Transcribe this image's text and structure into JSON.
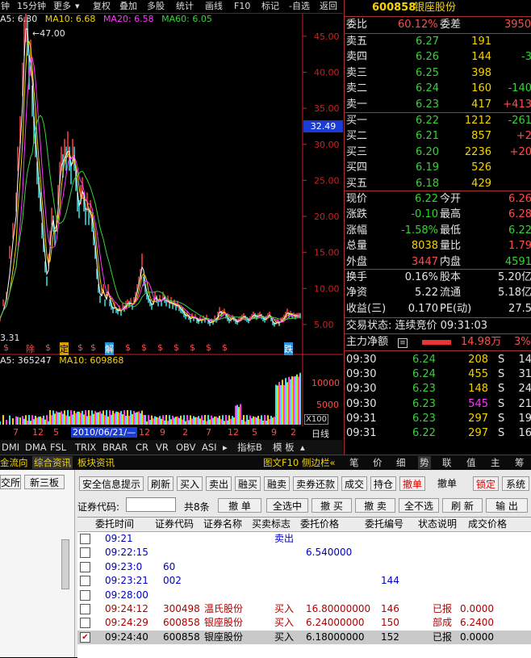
{
  "toolbar": {
    "items": [
      "钟",
      "15分钟",
      "更多",
      "复权",
      "叠加",
      "多股",
      "统计",
      "画线",
      "F10",
      "标记",
      "-自选",
      "返回"
    ]
  },
  "main_chart": {
    "ma_label": "A5: 6.30",
    "ma10_label": "MA10: 6.68",
    "ma20_label": "MA20: 6.58",
    "ma60_label": "MA60: 6.05",
    "peak_label": "47.00",
    "low_label": "3.31",
    "price_tag": "32.49",
    "markers": [
      "$",
      "除",
      "定",
      "解",
      "跌"
    ],
    "colors": {
      "ma5": "#ffffff",
      "ma10": "#f5d300",
      "ma20": "#ff37ff",
      "ma60": "#37d237",
      "axis": "#cc2222"
    }
  },
  "chart_data": {
    "type": "line",
    "y_ticks": [
      "45.00",
      "40.00",
      "35.00",
      "30.00",
      "25.00",
      "20.00",
      "15.00",
      "10.00",
      "5.00"
    ],
    "ylim": [
      3.31,
      47.0
    ],
    "price_path": [
      [
        0,
        5.8
      ],
      [
        4,
        8
      ],
      [
        8,
        9
      ],
      [
        12,
        15
      ],
      [
        16,
        18
      ],
      [
        20,
        22
      ],
      [
        22,
        28
      ],
      [
        25,
        32
      ],
      [
        28,
        39
      ],
      [
        30,
        45
      ],
      [
        32,
        47
      ],
      [
        34,
        45
      ],
      [
        36,
        40
      ],
      [
        38,
        42
      ],
      [
        40,
        36
      ],
      [
        42,
        32
      ],
      [
        44,
        30
      ],
      [
        46,
        26
      ],
      [
        48,
        24
      ],
      [
        50,
        22
      ],
      [
        52,
        18
      ],
      [
        54,
        16
      ],
      [
        56,
        13
      ],
      [
        58,
        11
      ],
      [
        60,
        14
      ],
      [
        62,
        17
      ],
      [
        64,
        20
      ],
      [
        66,
        19
      ],
      [
        68,
        17
      ],
      [
        70,
        19
      ],
      [
        72,
        23
      ],
      [
        74,
        26
      ],
      [
        76,
        28
      ],
      [
        78,
        27
      ],
      [
        80,
        29
      ],
      [
        82,
        28
      ],
      [
        84,
        30
      ],
      [
        86,
        28
      ],
      [
        88,
        26
      ],
      [
        90,
        29
      ],
      [
        92,
        28
      ],
      [
        94,
        25
      ],
      [
        96,
        22
      ],
      [
        98,
        21
      ],
      [
        100,
        23
      ],
      [
        102,
        24
      ],
      [
        104,
        22
      ],
      [
        106,
        20
      ],
      [
        108,
        22
      ],
      [
        110,
        20
      ],
      [
        112,
        21
      ],
      [
        114,
        19
      ],
      [
        116,
        17
      ],
      [
        118,
        15
      ],
      [
        120,
        12
      ],
      [
        122,
        10
      ],
      [
        124,
        8.5
      ],
      [
        126,
        9.5
      ],
      [
        128,
        10
      ],
      [
        130,
        8
      ],
      [
        132,
        9
      ],
      [
        134,
        10
      ],
      [
        136,
        8
      ],
      [
        138,
        7.5
      ],
      [
        140,
        7
      ],
      [
        142,
        7.6
      ],
      [
        144,
        7
      ],
      [
        146,
        6.8
      ],
      [
        148,
        7.2
      ],
      [
        150,
        6.6
      ],
      [
        152,
        7.5
      ],
      [
        154,
        7.2
      ],
      [
        156,
        7.8
      ],
      [
        158,
        8
      ],
      [
        160,
        7.8
      ],
      [
        162,
        8.2
      ],
      [
        164,
        7.5
      ],
      [
        166,
        8.3
      ],
      [
        168,
        9
      ],
      [
        170,
        10
      ],
      [
        172,
        11
      ],
      [
        174,
        12
      ],
      [
        176,
        14
      ],
      [
        178,
        11
      ],
      [
        180,
        10
      ],
      [
        182,
        9
      ],
      [
        184,
        8.5
      ],
      [
        186,
        8
      ],
      [
        188,
        7.5
      ],
      [
        190,
        8.2
      ],
      [
        192,
        9
      ],
      [
        194,
        8.5
      ],
      [
        196,
        8
      ],
      [
        198,
        8.6
      ],
      [
        200,
        8
      ],
      [
        202,
        9
      ],
      [
        204,
        8.5
      ],
      [
        206,
        8
      ],
      [
        208,
        8.5
      ],
      [
        210,
        7.7
      ],
      [
        212,
        8.3
      ],
      [
        214,
        7.6
      ],
      [
        216,
        8
      ],
      [
        218,
        7.4
      ],
      [
        220,
        7.8
      ],
      [
        222,
        7.3
      ],
      [
        224,
        7
      ],
      [
        226,
        6.9
      ],
      [
        228,
        6.4
      ],
      [
        230,
        6.1
      ],
      [
        232,
        6.4
      ],
      [
        234,
        6
      ],
      [
        236,
        5.6
      ],
      [
        238,
        6.2
      ],
      [
        240,
        5.8
      ],
      [
        242,
        6.1
      ],
      [
        244,
        5.5
      ],
      [
        246,
        5.4
      ],
      [
        248,
        5.8
      ],
      [
        250,
        5.5
      ],
      [
        252,
        5.9
      ],
      [
        254,
        5.6
      ],
      [
        256,
        6
      ],
      [
        258,
        5.4
      ],
      [
        260,
        5.1
      ],
      [
        262,
        5.5
      ],
      [
        264,
        5.3
      ],
      [
        266,
        5.9
      ],
      [
        268,
        5.6
      ],
      [
        270,
        6.4
      ],
      [
        272,
        7
      ],
      [
        274,
        6.5
      ],
      [
        276,
        6.6
      ],
      [
        278,
        6.8
      ],
      [
        280,
        6.2
      ],
      [
        282,
        5.8
      ],
      [
        284,
        5.5
      ],
      [
        286,
        5.7
      ],
      [
        288,
        6
      ],
      [
        290,
        5.8
      ],
      [
        292,
        5.4
      ],
      [
        294,
        5.3
      ],
      [
        296,
        5.6
      ],
      [
        298,
        5.8
      ],
      [
        300,
        6
      ],
      [
        302,
        6.2
      ],
      [
        304,
        5.9
      ],
      [
        306,
        5.7
      ],
      [
        308,
        5.5
      ],
      [
        310,
        5.8
      ],
      [
        312,
        6.1
      ],
      [
        314,
        6.4
      ],
      [
        316,
        6.2
      ],
      [
        318,
        6
      ],
      [
        320,
        6.2
      ],
      [
        322,
        6.4
      ],
      [
        324,
        6.1
      ],
      [
        326,
        5.8
      ],
      [
        328,
        5.6
      ],
      [
        330,
        5.9
      ],
      [
        332,
        6.2
      ],
      [
        334,
        6.4
      ],
      [
        336,
        5.8
      ],
      [
        338,
        5.2
      ],
      [
        340,
        5
      ],
      [
        342,
        5.3
      ],
      [
        344,
        5.4
      ],
      [
        346,
        5.1
      ],
      [
        348,
        5.6
      ],
      [
        350,
        5.7
      ],
      [
        352,
        6
      ],
      [
        354,
        6.4
      ],
      [
        356,
        6.8
      ],
      [
        358,
        6.3
      ],
      [
        360,
        6.5
      ],
      [
        362,
        6.2
      ],
      [
        364,
        6.3
      ],
      [
        366,
        6.1
      ],
      [
        368,
        6.2
      ],
      [
        370,
        6.25
      ],
      [
        372,
        6.22
      ]
    ]
  },
  "volume": {
    "label_a5": "A5: 365247",
    "label_ma10": "MA10: 609868",
    "ticks": [
      "10000",
      "5000",
      "X100"
    ],
    "date_tag": "2010/06/21/—",
    "date_ticks": [
      "7",
      "12",
      "5",
      "5",
      "12",
      "9",
      "2",
      "7",
      "12",
      "5",
      "9",
      "2"
    ]
  },
  "bottom_tabs": [
    "DMI",
    "DMA",
    "FSL",
    "TRIX",
    "BRAR",
    "CR",
    "VR",
    "OBV",
    "ASI",
    "指标B",
    "模 板",
    "日线"
  ],
  "tabs2": {
    "left": [
      "金流向",
      "综合资讯",
      "板块资讯"
    ],
    "right": [
      "图文F10",
      "侧边栏«",
      "笔",
      "价",
      "细",
      "势",
      "联",
      "值",
      "主",
      "筹"
    ]
  },
  "quote": {
    "code": "600858",
    "name": "银座股份",
    "wb_label": "委比",
    "wb_value": "60.12%",
    "wc_label": "委差",
    "wc_value": "3950",
    "sells": [
      {
        "label": "卖五",
        "price": "6.27",
        "vol": "191",
        "chg": ""
      },
      {
        "label": "卖四",
        "price": "6.26",
        "vol": "144",
        "chg": "-3"
      },
      {
        "label": "卖三",
        "price": "6.25",
        "vol": "398",
        "chg": ""
      },
      {
        "label": "卖二",
        "price": "6.24",
        "vol": "160",
        "chg": "-140"
      },
      {
        "label": "卖一",
        "price": "6.23",
        "vol": "417",
        "chg": "+413"
      }
    ],
    "buys": [
      {
        "label": "买一",
        "price": "6.22",
        "vol": "1212",
        "chg": "-261"
      },
      {
        "label": "买二",
        "price": "6.21",
        "vol": "857",
        "chg": "+2"
      },
      {
        "label": "买三",
        "price": "6.20",
        "vol": "2236",
        "chg": "+20"
      },
      {
        "label": "买四",
        "price": "6.19",
        "vol": "526",
        "chg": ""
      },
      {
        "label": "买五",
        "price": "6.18",
        "vol": "429",
        "chg": ""
      }
    ],
    "stats": [
      {
        "l1": "现价",
        "v1": "6.22",
        "l2": "今开",
        "v2": "6.26"
      },
      {
        "l1": "涨跌",
        "v1": "-0.10",
        "l2": "最高",
        "v2": "6.28"
      },
      {
        "l1": "涨幅",
        "v1": "-1.58%",
        "l2": "最低",
        "v2": "6.22"
      },
      {
        "l1": "总量",
        "v1": "8038",
        "l2": "量比",
        "v2": "1.79"
      },
      {
        "l1": "外盘",
        "v1": "3447",
        "l2": "内盘",
        "v2": "4591"
      }
    ],
    "stats2": [
      {
        "l1": "换手",
        "v1": "0.16%",
        "l2": "股本",
        "v2": "5.20亿"
      },
      {
        "l1": "净资",
        "v1": "5.22",
        "l2": "流通",
        "v2": "5.18亿"
      },
      {
        "l1": "收益(三)",
        "v1": "0.170",
        "l2": "PE(动)",
        "v2": "27.5"
      }
    ],
    "trade_status": "交易状态: 连续竞价 09:31:03",
    "main_net_label": "主力净额",
    "main_net_value": "14.98万",
    "main_net_pct": "3%",
    "ticks": [
      {
        "time": "09:30",
        "price": "6.24",
        "vol": "208",
        "side": "S",
        "n": "14"
      },
      {
        "time": "09:30",
        "price": "6.24",
        "vol": "455",
        "side": "S",
        "n": "31"
      },
      {
        "time": "09:30",
        "price": "6.23",
        "vol": "148",
        "side": "S",
        "n": "24"
      },
      {
        "time": "09:30",
        "price": "6.23",
        "vol": "545",
        "side": "S",
        "n": "21"
      },
      {
        "time": "09:31",
        "price": "6.23",
        "vol": "297",
        "side": "S",
        "n": "19"
      },
      {
        "time": "09:31",
        "price": "6.22",
        "vol": "297",
        "side": "S",
        "n": "16"
      }
    ]
  },
  "trade": {
    "left_tabs": [
      "交所",
      "新三板"
    ],
    "buttons": [
      "安全信息提示",
      "刷新",
      "买入",
      "卖出",
      "融买",
      "融卖",
      "卖券还款",
      "成交",
      "持仓",
      "撤单",
      "撤单",
      "锁定",
      "系统"
    ],
    "code_label": "证券代码:",
    "count_label": "共8条",
    "action_buttons": [
      "撤 单",
      "全选中",
      "撤 买",
      "撤 卖",
      "全不选",
      "刷 新",
      "输 出"
    ],
    "headers": [
      "委托时间",
      "证券代码",
      "证券名称",
      "买卖标志",
      "委托价格",
      "委托编号",
      "状态说明",
      "成交价格"
    ],
    "rows": [
      {
        "time": "09:21",
        "code": "",
        "name": "",
        "flag": "卖出",
        "price": "",
        "id": "",
        "status": "",
        "deal": ""
      },
      {
        "time": "09:22:15",
        "code": "",
        "name": "",
        "flag": "",
        "price": "6.540000",
        "id": "",
        "status": "",
        "deal": ""
      },
      {
        "time": "09:23:0",
        "code": "60",
        "name": "",
        "flag": "",
        "price": "",
        "id": "",
        "status": "",
        "deal": ""
      },
      {
        "time": "09:23:21",
        "code": "002",
        "name": "",
        "flag": "",
        "price": "",
        "id": "144",
        "status": "",
        "deal": ""
      },
      {
        "time": "09:28:00",
        "code": "",
        "name": "",
        "flag": "",
        "price": "",
        "id": "",
        "status": "",
        "deal": ""
      },
      {
        "time": "09:24:12",
        "code": "300498",
        "name": "温氏股份",
        "flag": "买入",
        "price": "16.80000000",
        "id": "146",
        "status": "已报",
        "deal": "0.0000"
      },
      {
        "time": "09:24:29",
        "code": "600858",
        "name": "银座股份",
        "flag": "买入",
        "price": "6.24000000",
        "id": "150",
        "status": "部成",
        "deal": "6.2400"
      },
      {
        "time": "09:24:40",
        "code": "600858",
        "name": "银座股份",
        "flag": "买入",
        "price": "6.18000000",
        "id": "152",
        "status": "已报",
        "deal": "0.0000"
      }
    ]
  }
}
